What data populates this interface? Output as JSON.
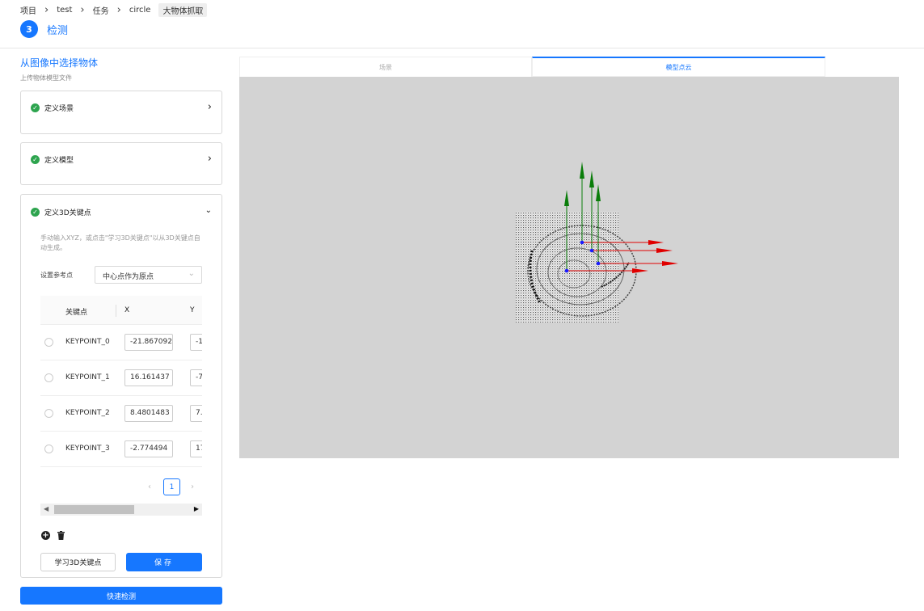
{
  "breadcrumb": {
    "items": [
      "项目",
      "test",
      "任务",
      "circle"
    ],
    "current": "大物体抓取"
  },
  "step": {
    "number": "3",
    "label": "检测"
  },
  "left": {
    "title": "从图像中选择物体",
    "subtitle": "上传物体模型文件",
    "sections": {
      "scene": "定义场景",
      "model": "定义模型",
      "keypoints": "定义3D关键点"
    },
    "keypoints": {
      "description": "手动输入XYZ，或点击\"学习3D关键点\"以从3D关键点自动生成。",
      "ref_label": "设置参考点",
      "ref_value": "中心点作为原点",
      "columns": {
        "name": "关键点",
        "x": "X",
        "y": "Y"
      },
      "rows": [
        {
          "name": "KEYPOINT_0",
          "x": "-21.867092",
          "y": "-1"
        },
        {
          "name": "KEYPOINT_1",
          "x": "16.161437",
          "y": "-7"
        },
        {
          "name": "KEYPOINT_2",
          "x": "8.4801483",
          "y": "7."
        },
        {
          "name": "KEYPOINT_3",
          "x": "-2.774494",
          "y": "17"
        }
      ],
      "page": "1",
      "learn_button": "学习3D关键点",
      "save_button": "保存"
    },
    "quick_detect_button": "快速检测"
  },
  "tabs": {
    "scene": "场景",
    "model": "模型点云"
  },
  "colors": {
    "accent": "#1677ff",
    "success": "#2da44e",
    "viewer_bg": "#d3d3d3",
    "axis_x": "#e00000",
    "axis_z": "#0a7d0a",
    "point": "#1a1aff"
  },
  "icons": {
    "check": "check-circle-icon",
    "chevron_right": "chevron-right-icon",
    "chevron_down": "chevron-down-icon",
    "add": "plus-circle-icon",
    "delete": "trash-icon"
  }
}
